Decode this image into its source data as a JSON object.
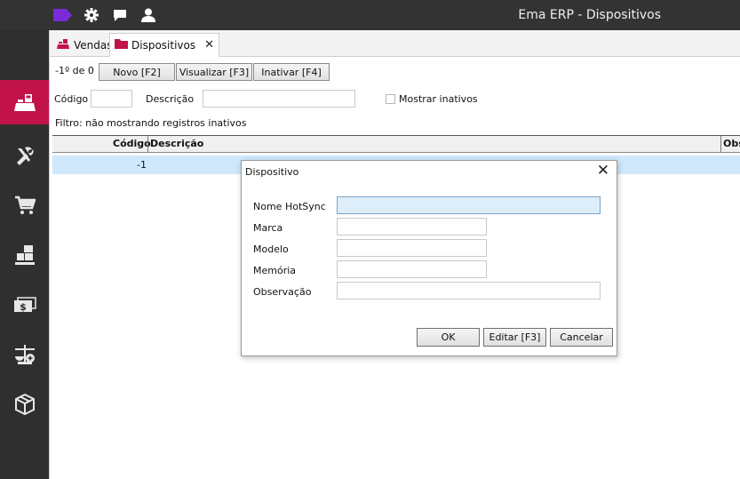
{
  "window": {
    "title": "Ema ERP - Dispositivos"
  },
  "topbar_icons": [
    "tag-icon",
    "gear-icon",
    "chat-icon",
    "user-icon"
  ],
  "sidebar": {
    "items": [
      {
        "name": "cash-register-icon",
        "active": true
      },
      {
        "name": "tools-icon",
        "active": false
      },
      {
        "name": "cart-icon",
        "active": false
      },
      {
        "name": "boxes-icon",
        "active": false
      },
      {
        "name": "money-icon",
        "active": false
      },
      {
        "name": "scale-icon",
        "active": false
      },
      {
        "name": "package-icon",
        "active": false
      }
    ]
  },
  "tabs": [
    {
      "label": "Vendas",
      "icon": "cash-register-icon",
      "active": false
    },
    {
      "label": "Dispositivos",
      "icon": "folder-icon",
      "active": true,
      "close": "✕"
    }
  ],
  "toolbar": {
    "record_count": "-1º de 0",
    "new_label": "Novo [F2]",
    "view_label": "Visualizar [F3]",
    "inactivate_label": "Inativar [F4]"
  },
  "filters": {
    "code_label": "Código",
    "code_value": "",
    "description_label": "Descrição",
    "description_value": "",
    "show_inactive_label": "Mostrar inativos",
    "show_inactive_checked": false,
    "filter_text": "Filtro:  não mostrando registros inativos"
  },
  "grid": {
    "columns": [
      "Código",
      "Descrição",
      "Obs"
    ],
    "rows": [
      {
        "codigo": "-1",
        "descricao": "",
        "obs": ""
      }
    ]
  },
  "dialog": {
    "title": "Dispositivo",
    "close": "✕",
    "fields": [
      {
        "label": "Nome HotSync",
        "value": ""
      },
      {
        "label": "Marca",
        "value": ""
      },
      {
        "label": "Modelo",
        "value": ""
      },
      {
        "label": "Memória",
        "value": ""
      },
      {
        "label": "Observação",
        "value": ""
      }
    ],
    "ok_label": "OK",
    "edit_label": "Editar [F3]",
    "cancel_label": "Cancelar"
  },
  "colors": {
    "accent": "#c2124a",
    "topbar": "#333333",
    "sidebar": "#2f2f2f",
    "selected_row": "#cfe8fb",
    "brand_tag": "#7a2bd6"
  }
}
